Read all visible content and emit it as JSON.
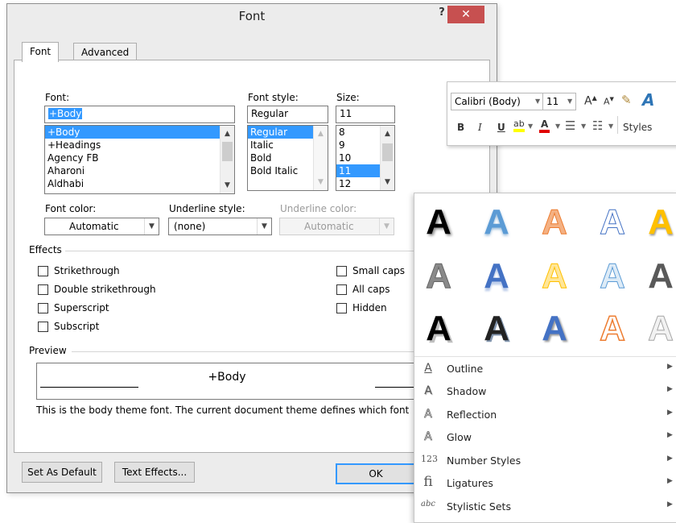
{
  "dialog": {
    "title": "Font",
    "help": "?",
    "close": "✕",
    "tabs": [
      {
        "label": "Font",
        "active": true
      },
      {
        "label": "Advanced",
        "active": false
      }
    ],
    "font": {
      "label": "Font:",
      "value": "+Body",
      "items": [
        "+Body",
        "+Headings",
        "Agency FB",
        "Aharoni",
        "Aldhabi"
      ],
      "selected_index": 0
    },
    "font_style": {
      "label": "Font style:",
      "value": "Regular",
      "items": [
        "Regular",
        "Italic",
        "Bold",
        "Bold Italic"
      ],
      "selected_index": 0
    },
    "size": {
      "label": "Size:",
      "value": "11",
      "items": [
        "8",
        "9",
        "10",
        "11",
        "12"
      ],
      "selected_index": 3
    },
    "font_color": {
      "label": "Font color:",
      "value": "Automatic"
    },
    "underline_style": {
      "label": "Underline style:",
      "value": "(none)"
    },
    "underline_color": {
      "label": "Underline color:",
      "value": "Automatic",
      "disabled": true
    },
    "effects": {
      "label": "Effects",
      "left": [
        "Strikethrough",
        "Double strikethrough",
        "Superscript",
        "Subscript"
      ],
      "right": [
        "Small caps",
        "All caps",
        "Hidden"
      ]
    },
    "preview": {
      "label": "Preview",
      "sample": "+Body",
      "description": "This is the body theme font. The current document theme defines which font"
    },
    "buttons": {
      "set_default": "Set As Default",
      "text_effects": "Text Effects...",
      "ok": "OK"
    }
  },
  "mini_toolbar": {
    "font_name": "Calibri (Body)",
    "font_size": "11",
    "grow": "A",
    "shrink": "A",
    "bold": "B",
    "italic": "I",
    "underline": "U",
    "highlight": "ab",
    "font_color": "A",
    "styles": "Styles"
  },
  "text_effects_gallery": {
    "sample_letter": "A",
    "menu": [
      {
        "label": "Outline",
        "icon": "outline-icon"
      },
      {
        "label": "Shadow",
        "icon": "shadow-icon"
      },
      {
        "label": "Reflection",
        "icon": "reflection-icon"
      },
      {
        "label": "Glow",
        "icon": "glow-icon"
      },
      {
        "label": "Number Styles",
        "icon": "number-styles-icon",
        "glyph": "123"
      },
      {
        "label": "Ligatures",
        "icon": "ligatures-icon",
        "glyph": "fi"
      },
      {
        "label": "Stylistic Sets",
        "icon": "stylistic-sets-icon",
        "glyph": "abc"
      }
    ],
    "colors": {
      "accent_blue": "#4472c4",
      "orange": "#ed7d31",
      "gold": "#ffc000",
      "gray": "#7f7f7f",
      "red_close": "#c75050"
    }
  }
}
